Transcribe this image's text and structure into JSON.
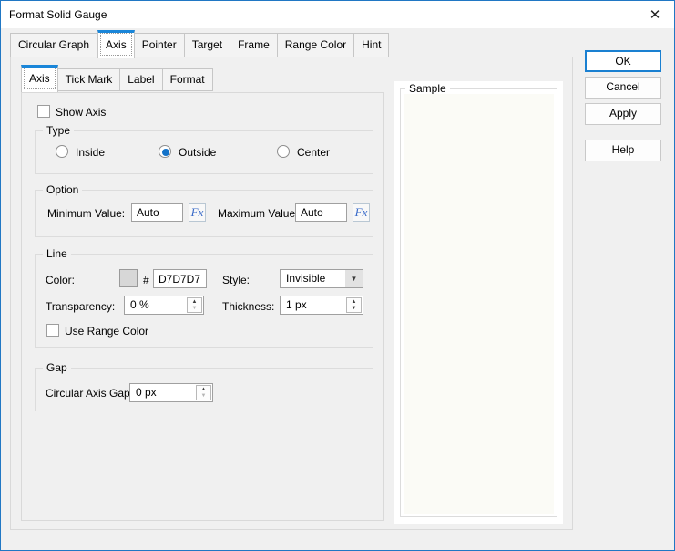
{
  "window": {
    "title": "Format Solid Gauge",
    "close_icon": "✕"
  },
  "tabs": {
    "outer": [
      {
        "label": "Circular Graph",
        "selected": false
      },
      {
        "label": "Axis",
        "selected": true
      },
      {
        "label": "Pointer",
        "selected": false
      },
      {
        "label": "Target",
        "selected": false
      },
      {
        "label": "Frame",
        "selected": false
      },
      {
        "label": "Range Color",
        "selected": false
      },
      {
        "label": "Hint",
        "selected": false
      }
    ],
    "inner": [
      {
        "label": "Axis",
        "selected": true
      },
      {
        "label": "Tick Mark",
        "selected": false
      },
      {
        "label": "Label",
        "selected": false
      },
      {
        "label": "Format",
        "selected": false
      }
    ]
  },
  "panel": {
    "show_axis": {
      "label": "Show Axis",
      "checked": false
    },
    "type_group": {
      "legend": "Type",
      "options": [
        {
          "label": "Inside",
          "selected": false
        },
        {
          "label": "Outside",
          "selected": true
        },
        {
          "label": "Center",
          "selected": false
        }
      ]
    },
    "option_group": {
      "legend": "Option",
      "min_label": "Minimum Value:",
      "min_value": "Auto",
      "max_label": "Maximum Value:",
      "max_value": "Auto",
      "fx_label": "Fx"
    },
    "line_group": {
      "legend": "Line",
      "color_label": "Color:",
      "hash": "#",
      "color_hex": "D7D7D7",
      "color_swatch": "#d7d7d7",
      "style_label": "Style:",
      "style_value": "Invisible",
      "dropdown_icon": "▼",
      "transparency_label": "Transparency:",
      "transparency_value": "0 %",
      "thickness_label": "Thickness:",
      "thickness_value": "1 px",
      "use_range_color": {
        "label": "Use Range Color",
        "checked": false
      },
      "spinner_up_icon": "▲",
      "spinner_down_icon": "▼"
    },
    "gap_group": {
      "legend": "Gap",
      "gap_label": "Circular Axis Gap:",
      "gap_value": "0 px"
    }
  },
  "sample_group": {
    "legend": "Sample"
  },
  "buttons": {
    "ok": "OK",
    "cancel": "Cancel",
    "apply": "Apply",
    "help": "Help"
  },
  "colors": {
    "accent_tab": "#1a86d9",
    "dialog_border": "#2077c4",
    "radio_dot": "#1473c9",
    "swatch": "#d7d7d7",
    "fx_text": "#3a6bc9",
    "body_bg": "#f0f0f0"
  }
}
